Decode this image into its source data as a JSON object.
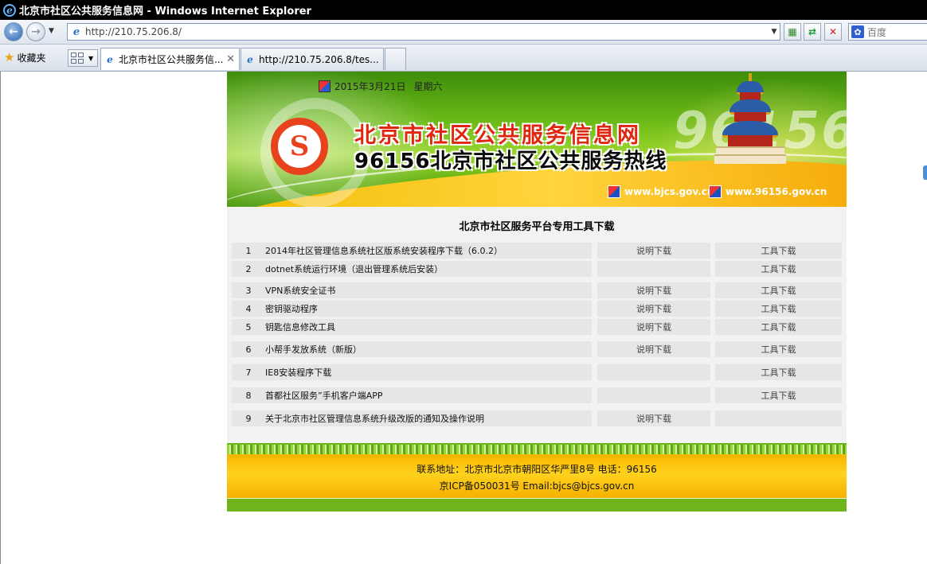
{
  "window": {
    "title": "北京市社区公共服务信息网 - Windows Internet Explorer",
    "url": "http://210.75.206.8/",
    "search_placeholder": "百度",
    "favorites_label": "收藏夹",
    "tabs": [
      {
        "label": "北京市社区公共服务信...",
        "active": true
      },
      {
        "label": "http://210.75.206.8/tes...",
        "active": false
      }
    ]
  },
  "banner": {
    "date": "2015年3月21日",
    "weekday": "星期六",
    "title_line1": "北京市社区公共服务信息网",
    "title_line2": "96156北京市社区公共服务热线",
    "watermark": "96156",
    "links": [
      "www.bjcs.gov.cn",
      "www.96156.gov.cn"
    ]
  },
  "panel": {
    "title": "北京市社区服务平台专用工具下载",
    "rows": [
      {
        "num": "1",
        "name": "2014年社区管理信息系统社区版系统安装程序下载（6.0.2）",
        "doc": "说明下载",
        "tool": "工具下载"
      },
      {
        "num": "2",
        "name": "dotnet系统运行环境（退出管理系统后安装）",
        "doc": "",
        "tool": "工具下载"
      },
      {
        "num": "3",
        "name": "VPN系统安全证书",
        "doc": "说明下载",
        "tool": "工具下载"
      },
      {
        "num": "4",
        "name": "密钥驱动程序",
        "doc": "说明下载",
        "tool": "工具下载"
      },
      {
        "num": "5",
        "name": "钥匙信息修改工具",
        "doc": "说明下载",
        "tool": "工具下载"
      },
      {
        "num": "6",
        "name": "小帮手发放系统（新版）",
        "doc": "说明下载",
        "tool": "工具下载"
      },
      {
        "num": "7",
        "name": "IE8安装程序下载",
        "doc": "",
        "tool": "工具下载"
      },
      {
        "num": "8",
        "name": "首都社区服务”手机客户端APP",
        "doc": "",
        "tool": "工具下载"
      },
      {
        "num": "9",
        "name": "关于北京市社区管理信息系统升级改版的通知及操作说明",
        "doc": "说明下载",
        "tool": ""
      }
    ]
  },
  "footer": {
    "line1": "联系地址：北京市北京市朝阳区华严里8号 电话：96156",
    "line2": "京ICP备050031号 Email:bjcs@bjcs.gov.cn"
  }
}
